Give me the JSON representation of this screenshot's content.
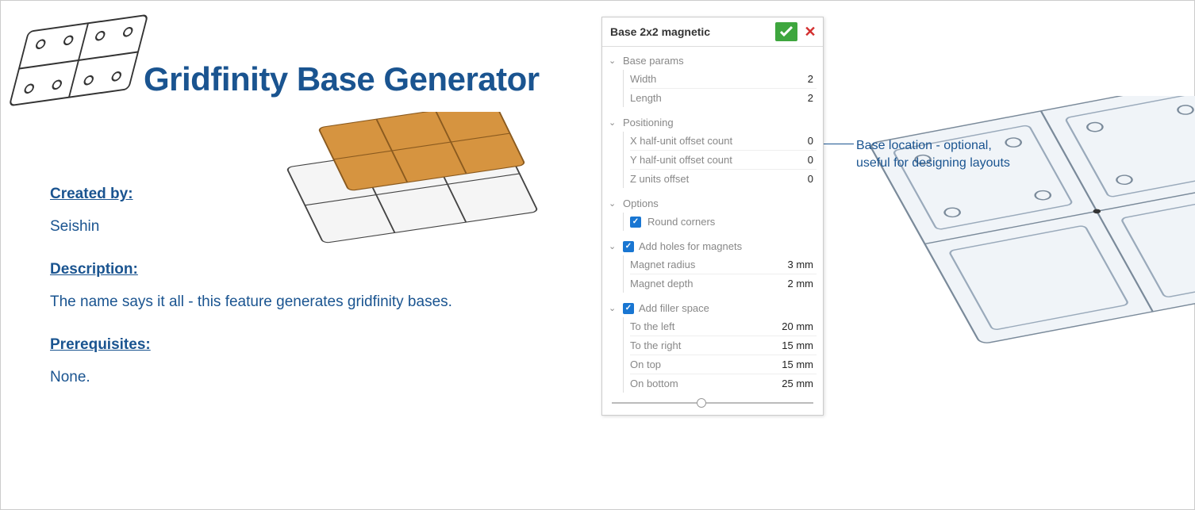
{
  "title": "Gridfinity Base Generator",
  "created_by_label": "Created by:",
  "created_by_value": "Seishin",
  "description_label": "Description:",
  "description_value": "The name says it all - this feature generates gridfinity bases.",
  "prerequisites_label": "Prerequisites:",
  "prerequisites_value": "None.",
  "annotation": "Base location - optional, useful for designing layouts",
  "panel": {
    "title": "Base 2x2 magnetic",
    "base_params": {
      "header": "Base params",
      "width_label": "Width",
      "width_value": "2",
      "length_label": "Length",
      "length_value": "2"
    },
    "positioning": {
      "header": "Positioning",
      "x_label": "X half-unit offset count",
      "x_value": "0",
      "y_label": "Y half-unit offset count",
      "y_value": "0",
      "z_label": "Z units offset",
      "z_value": "0"
    },
    "options": {
      "header": "Options",
      "round_corners": "Round corners"
    },
    "magnets": {
      "header": "Add holes for magnets",
      "radius_label": "Magnet radius",
      "radius_value": "3 mm",
      "depth_label": "Magnet depth",
      "depth_value": "2 mm"
    },
    "filler": {
      "header": "Add filler space",
      "left_label": "To the left",
      "left_value": "20 mm",
      "right_label": "To the right",
      "right_value": "15 mm",
      "top_label": "On top",
      "top_value": "15 mm",
      "bottom_label": "On bottom",
      "bottom_value": "25 mm"
    }
  }
}
